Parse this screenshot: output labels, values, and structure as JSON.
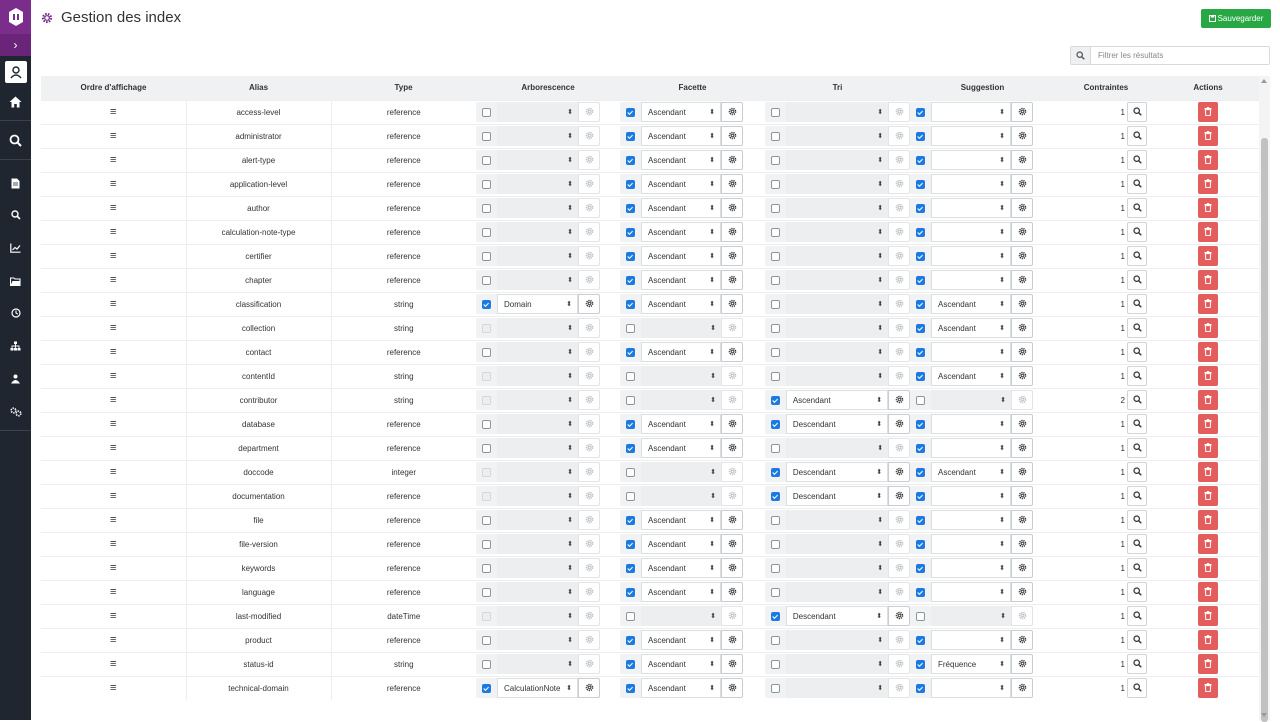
{
  "header": {
    "title": "Gestion des index",
    "save_label": "Sauvegarder"
  },
  "filter": {
    "placeholder": "Filtrer les résultats"
  },
  "columns": [
    "Ordre d'affichage",
    "Alias",
    "Type",
    "Arborescence",
    "Facette",
    "Tri",
    "Suggestion",
    "Contraintes",
    "Actions"
  ],
  "sidebar": {
    "icons": [
      "app-logo-icon",
      "expand-chevron-icon",
      "user-icon",
      "home-icon",
      "search-icon",
      "document-icon",
      "search-small-icon",
      "chart-icon",
      "folder-icon",
      "clock-icon",
      "sitemap-icon",
      "users-building-icon",
      "settings-users-icon"
    ]
  },
  "colors": {
    "sidebar": "#1f2630",
    "brand": "#7b2d8b",
    "save": "#28a745",
    "delete": "#e35d5d",
    "check": "#1c7be0"
  },
  "rows": [
    {
      "alias": "access-level",
      "type": "reference",
      "arb": {
        "state": "off",
        "value": ""
      },
      "fac": {
        "state": "on",
        "value": "Ascendant"
      },
      "tri": {
        "state": "off",
        "value": ""
      },
      "sug": {
        "state": "on",
        "value": ""
      },
      "constraints": "1"
    },
    {
      "alias": "administrator",
      "type": "reference",
      "arb": {
        "state": "off",
        "value": ""
      },
      "fac": {
        "state": "on",
        "value": "Ascendant"
      },
      "tri": {
        "state": "off",
        "value": ""
      },
      "sug": {
        "state": "on",
        "value": ""
      },
      "constraints": "1"
    },
    {
      "alias": "alert-type",
      "type": "reference",
      "arb": {
        "state": "off",
        "value": ""
      },
      "fac": {
        "state": "on",
        "value": "Ascendant"
      },
      "tri": {
        "state": "off",
        "value": ""
      },
      "sug": {
        "state": "on",
        "value": ""
      },
      "constraints": "1"
    },
    {
      "alias": "application-level",
      "type": "reference",
      "arb": {
        "state": "off",
        "value": ""
      },
      "fac": {
        "state": "on",
        "value": "Ascendant"
      },
      "tri": {
        "state": "off",
        "value": ""
      },
      "sug": {
        "state": "on",
        "value": ""
      },
      "constraints": "1"
    },
    {
      "alias": "author",
      "type": "reference",
      "arb": {
        "state": "off",
        "value": ""
      },
      "fac": {
        "state": "on",
        "value": "Ascendant"
      },
      "tri": {
        "state": "off",
        "value": ""
      },
      "sug": {
        "state": "on",
        "value": ""
      },
      "constraints": "1"
    },
    {
      "alias": "calculation-note-type",
      "type": "reference",
      "arb": {
        "state": "off",
        "value": ""
      },
      "fac": {
        "state": "on",
        "value": "Ascendant"
      },
      "tri": {
        "state": "off",
        "value": ""
      },
      "sug": {
        "state": "on",
        "value": ""
      },
      "constraints": "1"
    },
    {
      "alias": "certifier",
      "type": "reference",
      "arb": {
        "state": "off",
        "value": ""
      },
      "fac": {
        "state": "on",
        "value": "Ascendant"
      },
      "tri": {
        "state": "off",
        "value": ""
      },
      "sug": {
        "state": "on",
        "value": ""
      },
      "constraints": "1"
    },
    {
      "alias": "chapter",
      "type": "reference",
      "arb": {
        "state": "off",
        "value": ""
      },
      "fac": {
        "state": "on",
        "value": "Ascendant"
      },
      "tri": {
        "state": "off",
        "value": ""
      },
      "sug": {
        "state": "on",
        "value": ""
      },
      "constraints": "1"
    },
    {
      "alias": "classification",
      "type": "string",
      "arb": {
        "state": "on",
        "value": "Domain"
      },
      "fac": {
        "state": "on",
        "value": "Ascendant"
      },
      "tri": {
        "state": "off",
        "value": ""
      },
      "sug": {
        "state": "on",
        "value": "Ascendant"
      },
      "constraints": "1"
    },
    {
      "alias": "collection",
      "type": "string",
      "arb": {
        "state": "dis",
        "value": ""
      },
      "fac": {
        "state": "off",
        "value": ""
      },
      "tri": {
        "state": "off",
        "value": ""
      },
      "sug": {
        "state": "on",
        "value": "Ascendant"
      },
      "constraints": "1"
    },
    {
      "alias": "contact",
      "type": "reference",
      "arb": {
        "state": "off",
        "value": ""
      },
      "fac": {
        "state": "on",
        "value": "Ascendant"
      },
      "tri": {
        "state": "off",
        "value": ""
      },
      "sug": {
        "state": "on",
        "value": ""
      },
      "constraints": "1"
    },
    {
      "alias": "contentId",
      "type": "string",
      "arb": {
        "state": "dis",
        "value": ""
      },
      "fac": {
        "state": "off",
        "value": ""
      },
      "tri": {
        "state": "off",
        "value": ""
      },
      "sug": {
        "state": "on",
        "value": "Ascendant"
      },
      "constraints": "1"
    },
    {
      "alias": "contributor",
      "type": "string",
      "arb": {
        "state": "dis",
        "value": ""
      },
      "fac": {
        "state": "off",
        "value": ""
      },
      "tri": {
        "state": "on",
        "value": "Ascendant"
      },
      "sug": {
        "state": "off",
        "value": ""
      },
      "constraints": "2"
    },
    {
      "alias": "database",
      "type": "reference",
      "arb": {
        "state": "off",
        "value": ""
      },
      "fac": {
        "state": "on",
        "value": "Ascendant"
      },
      "tri": {
        "state": "on",
        "value": "Descendant"
      },
      "sug": {
        "state": "on",
        "value": ""
      },
      "constraints": "1"
    },
    {
      "alias": "department",
      "type": "reference",
      "arb": {
        "state": "off",
        "value": ""
      },
      "fac": {
        "state": "on",
        "value": "Ascendant"
      },
      "tri": {
        "state": "off",
        "value": ""
      },
      "sug": {
        "state": "on",
        "value": ""
      },
      "constraints": "1"
    },
    {
      "alias": "doccode",
      "type": "integer",
      "arb": {
        "state": "dis",
        "value": ""
      },
      "fac": {
        "state": "off",
        "value": ""
      },
      "tri": {
        "state": "on",
        "value": "Descendant"
      },
      "sug": {
        "state": "on",
        "value": "Ascendant"
      },
      "constraints": "1"
    },
    {
      "alias": "documentation",
      "type": "reference",
      "arb": {
        "state": "dis",
        "value": ""
      },
      "fac": {
        "state": "off",
        "value": ""
      },
      "tri": {
        "state": "on",
        "value": "Descendant"
      },
      "sug": {
        "state": "on",
        "value": ""
      },
      "constraints": "1"
    },
    {
      "alias": "file",
      "type": "reference",
      "arb": {
        "state": "off",
        "value": ""
      },
      "fac": {
        "state": "on",
        "value": "Ascendant"
      },
      "tri": {
        "state": "off",
        "value": ""
      },
      "sug": {
        "state": "on",
        "value": ""
      },
      "constraints": "1"
    },
    {
      "alias": "file-version",
      "type": "reference",
      "arb": {
        "state": "off",
        "value": ""
      },
      "fac": {
        "state": "on",
        "value": "Ascendant"
      },
      "tri": {
        "state": "off",
        "value": ""
      },
      "sug": {
        "state": "on",
        "value": ""
      },
      "constraints": "1"
    },
    {
      "alias": "keywords",
      "type": "reference",
      "arb": {
        "state": "off",
        "value": ""
      },
      "fac": {
        "state": "on",
        "value": "Ascendant"
      },
      "tri": {
        "state": "off",
        "value": ""
      },
      "sug": {
        "state": "on",
        "value": ""
      },
      "constraints": "1"
    },
    {
      "alias": "language",
      "type": "reference",
      "arb": {
        "state": "off",
        "value": ""
      },
      "fac": {
        "state": "on",
        "value": "Ascendant"
      },
      "tri": {
        "state": "off",
        "value": ""
      },
      "sug": {
        "state": "on",
        "value": ""
      },
      "constraints": "1"
    },
    {
      "alias": "last-modified",
      "type": "dateTime",
      "arb": {
        "state": "dis",
        "value": ""
      },
      "fac": {
        "state": "off",
        "value": ""
      },
      "tri": {
        "state": "on",
        "value": "Descendant"
      },
      "sug": {
        "state": "off",
        "value": ""
      },
      "constraints": "1"
    },
    {
      "alias": "product",
      "type": "reference",
      "arb": {
        "state": "off",
        "value": ""
      },
      "fac": {
        "state": "on",
        "value": "Ascendant"
      },
      "tri": {
        "state": "off",
        "value": ""
      },
      "sug": {
        "state": "on",
        "value": ""
      },
      "constraints": "1"
    },
    {
      "alias": "status-id",
      "type": "string",
      "arb": {
        "state": "off",
        "value": ""
      },
      "fac": {
        "state": "on",
        "value": "Ascendant"
      },
      "tri": {
        "state": "off",
        "value": ""
      },
      "sug": {
        "state": "on",
        "value": "Fréquence"
      },
      "constraints": "1"
    },
    {
      "alias": "technical-domain",
      "type": "reference",
      "arb": {
        "state": "on",
        "value": "CalculationNote"
      },
      "fac": {
        "state": "on",
        "value": "Ascendant"
      },
      "tri": {
        "state": "off",
        "value": ""
      },
      "sug": {
        "state": "on",
        "value": ""
      },
      "constraints": "1"
    }
  ]
}
